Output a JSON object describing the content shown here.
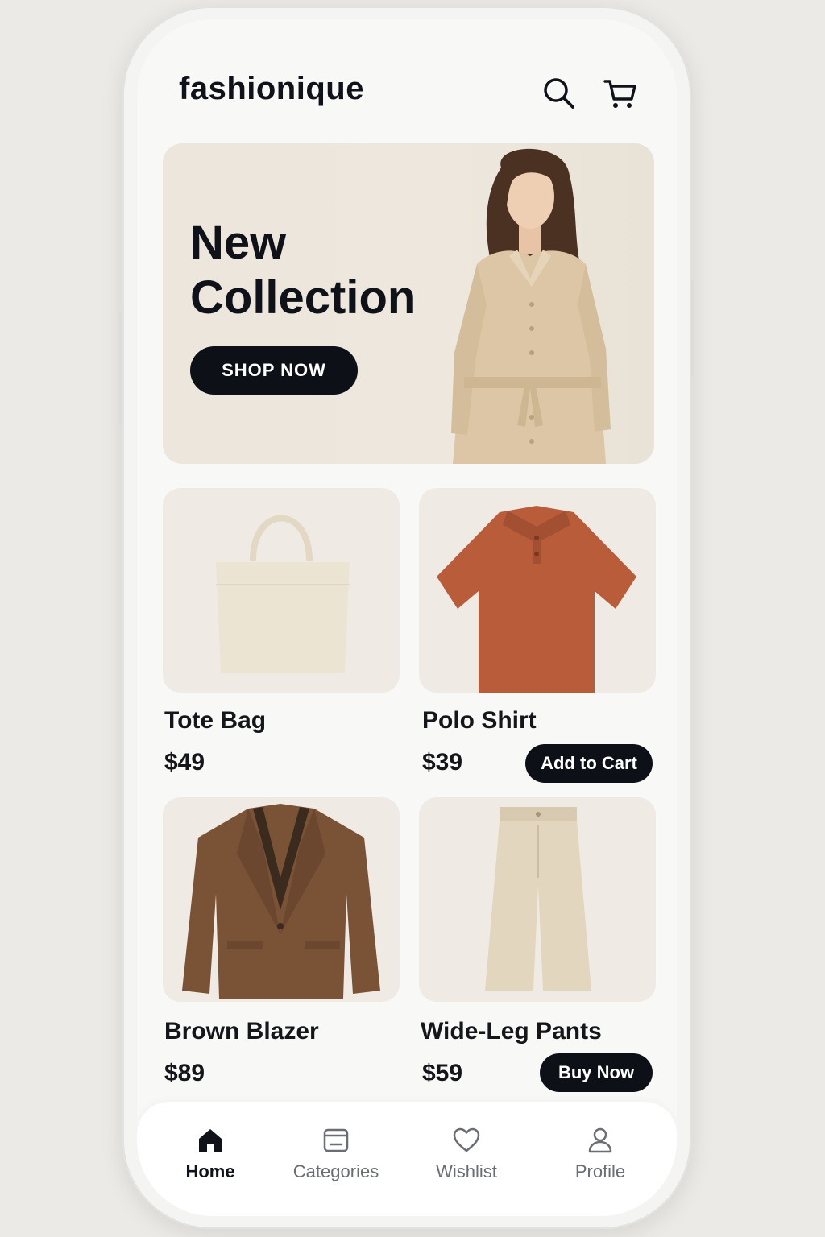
{
  "app": {
    "brand": "fashionique"
  },
  "header": {
    "search_icon": "search-icon",
    "cart_icon": "cart-icon"
  },
  "hero": {
    "title_line1": "New",
    "title_line2": "Collection",
    "cta_label": "SHOP NOW"
  },
  "products": [
    {
      "name": "Tote Bag",
      "price": "$49"
    },
    {
      "name": "Polo Shirt",
      "price": "$39",
      "action": "Add to Cart"
    },
    {
      "name": "Brown Blazer",
      "price": "$89"
    },
    {
      "name": "Wide-Leg Pants",
      "price": "$59",
      "action": "Buy Now"
    }
  ],
  "bottom_nav": {
    "items": [
      {
        "label": "Home",
        "icon": "home-icon",
        "active": true
      },
      {
        "label": "Categories",
        "icon": "categories-icon",
        "active": false
      },
      {
        "label": "Wishlist",
        "icon": "heart-icon",
        "active": false
      },
      {
        "label": "Profile",
        "icon": "user-icon",
        "active": false
      }
    ]
  },
  "colors": {
    "primary": "#0d1117",
    "background": "#f8f8f7",
    "card": "#efebe4",
    "tote": "#ece4d3",
    "polo": "#b85c3a",
    "blazer": "#7a5236",
    "pants": "#e3d6bf"
  }
}
